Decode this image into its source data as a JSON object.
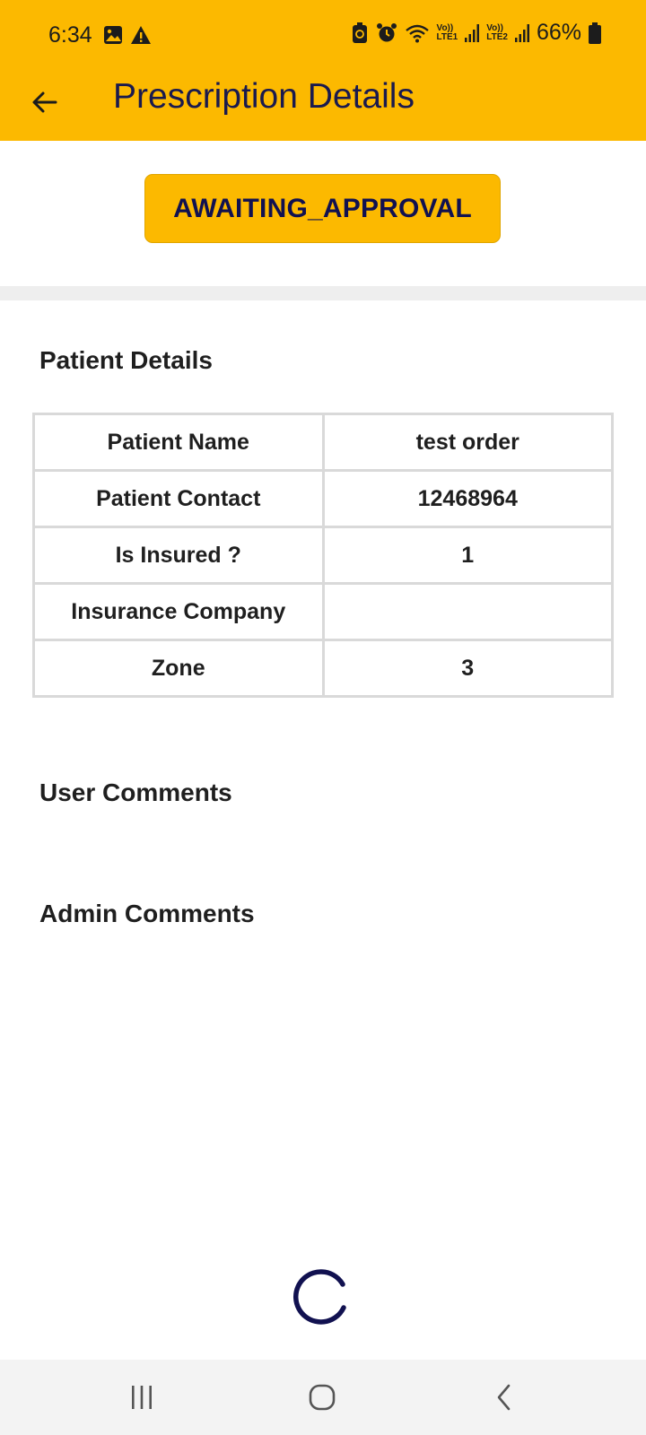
{
  "status_bar": {
    "time": "6:34",
    "sim1_label_top": "Vo))",
    "sim1_label_bottom": "LTE1",
    "sim2_label_top": "Vo))",
    "sim2_label_bottom": "LTE2",
    "battery": "66%"
  },
  "app_bar": {
    "title": "Prescription Details"
  },
  "order_status": {
    "label": "AWAITING_APPROVAL"
  },
  "patient_details": {
    "heading": "Patient Details",
    "rows": [
      {
        "label": "Patient Name",
        "value": "test order"
      },
      {
        "label": "Patient Contact",
        "value": "12468964"
      },
      {
        "label": "Is Insured ?",
        "value": "1"
      },
      {
        "label": "Insurance Company",
        "value": ""
      },
      {
        "label": "Zone",
        "value": "3"
      }
    ]
  },
  "user_comments": {
    "heading": "User Comments"
  },
  "admin_comments": {
    "heading": "Admin Comments"
  },
  "colors": {
    "primary": "#FCB900",
    "title_text": "#1a1a4e",
    "spinner": "#111150"
  }
}
